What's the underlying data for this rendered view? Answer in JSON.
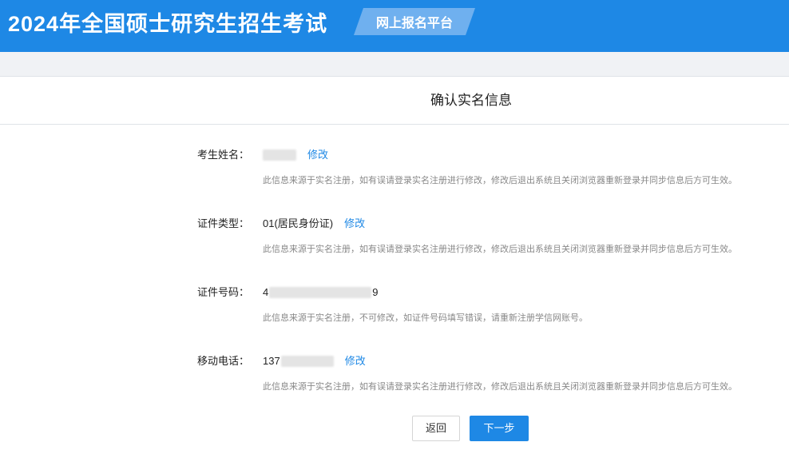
{
  "header": {
    "title": "2024年全国硕士研究生招生考试",
    "platform": "网上报名平台"
  },
  "page_title": "确认实名信息",
  "fields": {
    "name": {
      "label": "考生姓名：",
      "value_masked": true,
      "edit_label": "修改",
      "hint": "此信息来源于实名注册，如有误请登录实名注册进行修改，修改后退出系统且关闭浏览器重新登录并同步信息后方可生效。"
    },
    "id_type": {
      "label": "证件类型：",
      "value": "01(居民身份证)",
      "edit_label": "修改",
      "hint": "此信息来源于实名注册，如有误请登录实名注册进行修改，修改后退出系统且关闭浏览器重新登录并同步信息后方可生效。"
    },
    "id_number": {
      "label": "证件号码：",
      "value_prefix": "4",
      "value_suffix": "9",
      "hint": "此信息来源于实名注册，不可修改，如证件号码填写错误，请重新注册学信网账号。"
    },
    "phone": {
      "label": "移动电话：",
      "value_prefix": "137",
      "edit_label": "修改",
      "hint": "此信息来源于实名注册，如有误请登录实名注册进行修改，修改后退出系统且关闭浏览器重新登录并同步信息后方可生效。"
    }
  },
  "buttons": {
    "back": "返回",
    "next": "下一步"
  },
  "colors": {
    "header_bg": "#1e88e5",
    "badge_bg": "#6fb0ef",
    "link": "#1e88e5",
    "primary_button": "#1e88e5"
  }
}
